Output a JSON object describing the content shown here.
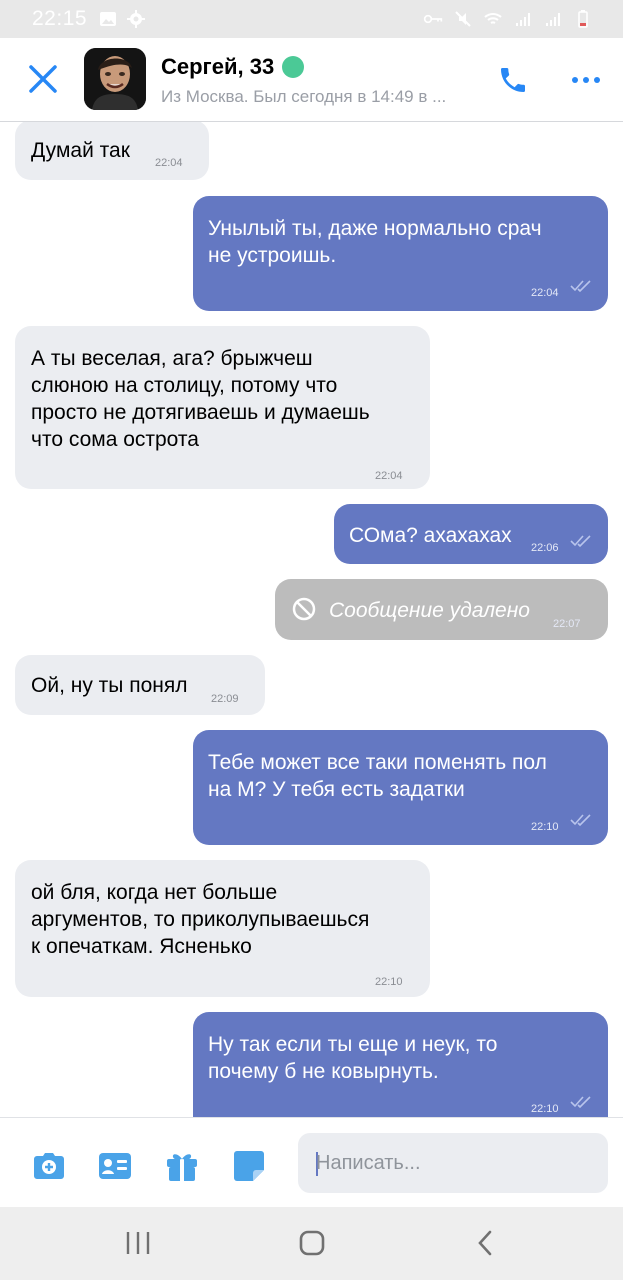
{
  "status_bar": {
    "time": "22:15",
    "left_icons": [
      "image-icon",
      "gear-icon"
    ],
    "right_icons": [
      "key-icon",
      "mute-icon",
      "wifi-icon",
      "signal-icon",
      "signal-icon",
      "battery-low-icon"
    ]
  },
  "header": {
    "name": "Сергей, 33",
    "status": "Из Москва. Был сегодня в 14:49 в ...",
    "online_color": "#4bc996",
    "accent_color": "#2787f5"
  },
  "messages": [
    {
      "direction": "in",
      "lines": [
        "Думай так"
      ],
      "time": "22:04"
    },
    {
      "direction": "out",
      "lines": [
        "Унылый ты, даже нормально срач",
        "не устроишь."
      ],
      "time": "22:04",
      "read": true
    },
    {
      "direction": "in",
      "lines": [
        "А ты веселая, ага? брыжчеш",
        "слюною на столицу, потому что",
        "просто не дотягиваешь и думаешь",
        "что сома острота"
      ],
      "time": "22:04"
    },
    {
      "direction": "out",
      "lines": [
        "СОма? ахахахах"
      ],
      "time": "22:06",
      "read": true
    },
    {
      "direction": "out",
      "deleted": true,
      "lines": [
        "Сообщение удалено"
      ],
      "time": "22:07"
    },
    {
      "direction": "in",
      "lines": [
        "Ой, ну ты понял"
      ],
      "time": "22:09"
    },
    {
      "direction": "out",
      "lines": [
        "Тебе может все таки поменять пол",
        "на М? У тебя есть задатки"
      ],
      "time": "22:10",
      "read": true
    },
    {
      "direction": "in",
      "lines": [
        "ой бля, когда нет больше",
        "аргументов, то приколупываешься",
        "к опечаткам. Ясненько"
      ],
      "time": "22:10"
    },
    {
      "direction": "out",
      "lines": [
        "Ну так если ты еще и неук, то",
        "почему б не ковырнуть."
      ],
      "time": "22:10",
      "read": true
    }
  ],
  "composer": {
    "placeholder": "Написать...",
    "value": "",
    "buttons": [
      "camera-plus-icon",
      "contact-card-icon",
      "gift-icon",
      "sticker-icon"
    ]
  },
  "navbar": {
    "buttons": [
      "recent-apps-icon",
      "home-icon",
      "back-icon"
    ]
  },
  "colors": {
    "incoming_bubble": "#ebedf1",
    "outgoing_bubble": "#6478c2",
    "deleted_bubble": "#bcbcbc"
  }
}
